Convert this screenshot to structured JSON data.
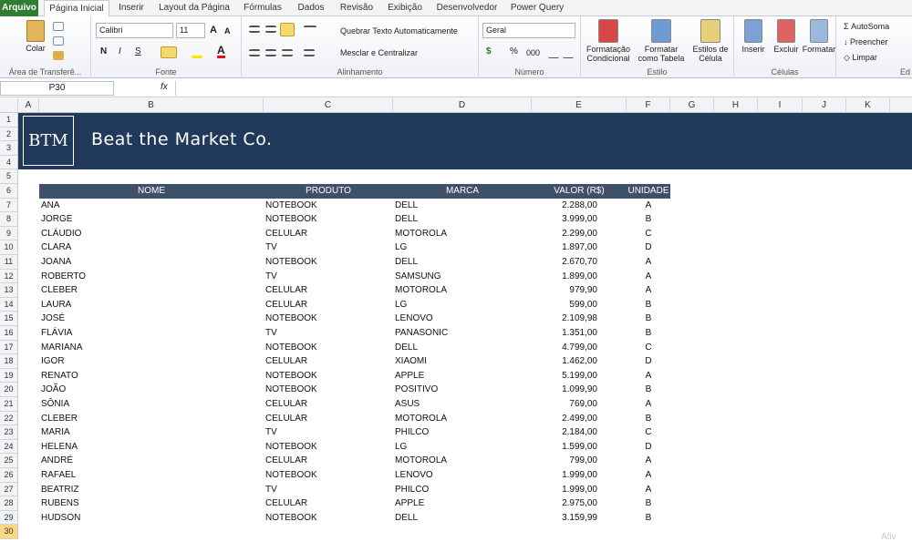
{
  "ribbon_tabs": [
    "Arquivo",
    "Página Inicial",
    "Inserir",
    "Layout da Página",
    "Fórmulas",
    "Dados",
    "Revisão",
    "Exibição",
    "Desenvolvedor",
    "Power Query"
  ],
  "ribbon": {
    "clipboard": {
      "paste": "Colar",
      "label": "Área de Transferê..."
    },
    "font": {
      "name": "Calibri",
      "size": "11",
      "label": "Fonte",
      "bold": "N",
      "italic": "I",
      "underline": "S"
    },
    "alignment": {
      "wrap": "Quebrar Texto Automaticamente",
      "merge": "Mesclar e Centralizar",
      "label": "Alinhamento"
    },
    "number": {
      "format": "Geral",
      "label": "Número",
      "currency": "$",
      "percent": "%",
      "thousands": "000"
    },
    "styles": {
      "conditional1": "Formatação",
      "conditional2": "Condicional",
      "table1": "Formatar",
      "table2": "como Tabela",
      "cell1": "Estilos de",
      "cell2": "Célula",
      "label": "Estilo"
    },
    "cells": {
      "insert": "Inserir",
      "delete": "Excluir",
      "format": "Formatar",
      "label": "Células"
    },
    "editing": {
      "autosum": "AutoSoma",
      "fill": "Preencher",
      "clear": "Limpar",
      "label": "Ed"
    }
  },
  "formula_bar": {
    "name_box": "P30",
    "fx": "fx",
    "value": ""
  },
  "columns": [
    "A",
    "B",
    "C",
    "D",
    "E",
    "F",
    "G",
    "H",
    "I",
    "J",
    "K"
  ],
  "rows": [
    "1",
    "2",
    "3",
    "4",
    "5",
    "6",
    "7",
    "8",
    "9",
    "10",
    "11",
    "12",
    "13",
    "14",
    "15",
    "16",
    "17",
    "18",
    "19",
    "20",
    "21",
    "22",
    "23",
    "24",
    "25",
    "26",
    "27",
    "28",
    "29",
    "30"
  ],
  "banner": {
    "logo": "BTM",
    "company": "Beat the Market Co."
  },
  "table": {
    "headers": [
      "NOME",
      "PRODUTO",
      "MARCA",
      "VALOR (R$)",
      "UNIDADE"
    ],
    "rows": [
      [
        "ANA",
        "NOTEBOOK",
        "DELL",
        "2.288,00",
        "A"
      ],
      [
        "JORGE",
        "NOTEBOOK",
        "DELL",
        "3.999,00",
        "B"
      ],
      [
        "CLÁUDIO",
        "CELULAR",
        "MOTOROLA",
        "2.299,00",
        "C"
      ],
      [
        "CLARA",
        "TV",
        "LG",
        "1.897,00",
        "D"
      ],
      [
        "JOANA",
        "NOTEBOOK",
        "DELL",
        "2.670,70",
        "A"
      ],
      [
        "ROBERTO",
        "TV",
        "SAMSUNG",
        "1.899,00",
        "A"
      ],
      [
        "CLEBER",
        "CELULAR",
        "MOTOROLA",
        "979,90",
        "A"
      ],
      [
        "LAURA",
        "CELULAR",
        "LG",
        "599,00",
        "B"
      ],
      [
        "JOSÉ",
        "NOTEBOOK",
        "LENOVO",
        "2.109,98",
        "B"
      ],
      [
        "FLÁVIA",
        "TV",
        "PANASONIC",
        "1.351,00",
        "B"
      ],
      [
        "MARIANA",
        "NOTEBOOK",
        "DELL",
        "4.799,00",
        "C"
      ],
      [
        "IGOR",
        "CELULAR",
        "XIAOMI",
        "1.462,00",
        "D"
      ],
      [
        "RENATO",
        "NOTEBOOK",
        "APPLE",
        "5.199,00",
        "A"
      ],
      [
        "JOÃO",
        "NOTEBOOK",
        "POSITIVO",
        "1.099,90",
        "B"
      ],
      [
        "SÔNIA",
        "CELULAR",
        "ASUS",
        "769,00",
        "A"
      ],
      [
        "CLEBER",
        "CELULAR",
        "MOTOROLA",
        "2.499,00",
        "B"
      ],
      [
        "MARIA",
        "TV",
        "PHILCO",
        "2.184,00",
        "C"
      ],
      [
        "HELENA",
        "NOTEBOOK",
        "LG",
        "1.599,00",
        "D"
      ],
      [
        "ANDRÉ",
        "CELULAR",
        "MOTOROLA",
        "799,00",
        "A"
      ],
      [
        "RAFAEL",
        "NOTEBOOK",
        "LENOVO",
        "1.999,00",
        "A"
      ],
      [
        "BEATRIZ",
        "TV",
        "PHILCO",
        "1.999,00",
        "A"
      ],
      [
        "RUBENS",
        "CELULAR",
        "APPLE",
        "2.975,00",
        "B"
      ],
      [
        "HUDSON",
        "NOTEBOOK",
        "DELL",
        "3.159,99",
        "B"
      ]
    ]
  },
  "watermark": "Ativ"
}
